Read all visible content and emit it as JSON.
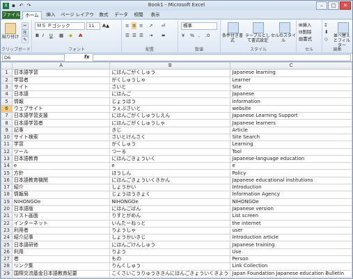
{
  "title": "Book1 - Microsoft Excel",
  "window_buttons": {
    "minimize": "–",
    "maximize": "□",
    "close": "✕"
  },
  "tabs": [
    "ファイル",
    "ホーム",
    "挿入",
    "ページ レイアウト",
    "数式",
    "データ",
    "校閲",
    "表示"
  ],
  "ribbon": {
    "paste": "貼り付け",
    "clipboard": "クリップボード",
    "font_name": "ＭＳ Ｐゴシック",
    "font_size": "11",
    "font_group": "フォント",
    "alignment_group": "配置",
    "number_format": "標準",
    "number_group": "数値",
    "cond_format": "条件付き書式",
    "table_format": "テーブルとして書式設定",
    "cell_style": "セルのスタイル",
    "style_group": "スタイル",
    "insert": "挿入",
    "delete": "削除",
    "format": "書式",
    "cells_group": "セル",
    "sort_filter": "並べ替えとフィルター",
    "edit_group": "編集"
  },
  "name_box": "D6",
  "fx_label": "fx",
  "columns": [
    "A",
    "B",
    "C"
  ],
  "selected_row": 6,
  "rows": [
    [
      "日本語学習",
      "にほんごがくしゅう",
      "Japanese learning"
    ],
    [
      "学習者",
      "がくしゅうしゃ",
      "Learner"
    ],
    [
      "サイト",
      "さいと",
      "Site"
    ],
    [
      "日本語",
      "にほんご",
      "Japanese"
    ],
    [
      "情報",
      "じょうほう",
      "Information"
    ],
    [
      "ウェブサイト",
      "うぇぶさいと",
      "website"
    ],
    [
      "日本語学習支援",
      "にほんごがくしゅうしえん",
      "Japanese Learning Support"
    ],
    [
      "日本語学習者",
      "にほんごがくしゅうしゃ",
      "Japanese learners"
    ],
    [
      "記事",
      "きじ",
      "Article"
    ],
    [
      "サイト検索",
      "さいとけんさく",
      "Site Search"
    ],
    [
      "学習",
      "がくしゅう",
      "Learning"
    ],
    [
      "ツール",
      "つーる",
      "Tool"
    ],
    [
      "日本語教育",
      "にほんごきょういく",
      "Japanese-language education"
    ],
    [
      "e",
      "e",
      "e"
    ],
    [
      "方針",
      "ほうしん",
      "Policy"
    ],
    [
      "日本語教育機関",
      "にほんごきょういくきかん",
      "Japanese educational institutions"
    ],
    [
      "紹介",
      "しょうかい",
      "Introduction"
    ],
    [
      "情報局",
      "じょうほうきょく",
      "Information Agency"
    ],
    [
      "NIHONGOe",
      "NIHONGOe",
      "NIHONGOe"
    ],
    [
      "日本語版",
      "にほんごばん",
      "Japanese version"
    ],
    [
      "リスト画面",
      "りすとがめん",
      "List screen"
    ],
    [
      "インターネット",
      "いんたーねっと",
      "the internet"
    ],
    [
      "利用者",
      "りようしゃ",
      "user"
    ],
    [
      "紹介記事",
      "しょうかいきじ",
      "Introduction article"
    ],
    [
      "日本語研修",
      "にほんごけんしゅう",
      "Japanese training"
    ],
    [
      "利用",
      "りよう",
      "Use"
    ],
    [
      "者",
      "もの",
      "Person"
    ],
    [
      "リンク集",
      "りんくしゅう",
      "Link Collection"
    ],
    [
      "国際交流基金日本語教育紀要",
      "こくさいこうりゅうききんにほんごきょういくきよう",
      "Japan Foundation Japanese education Bulletin"
    ]
  ]
}
